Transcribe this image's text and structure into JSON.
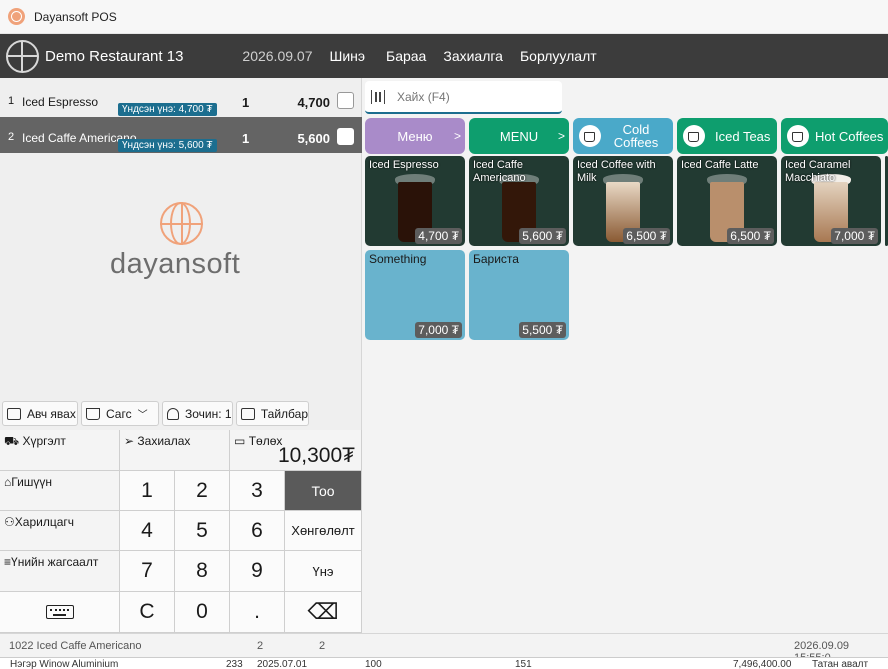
{
  "window": {
    "title": "Dayansoft POS"
  },
  "header": {
    "restaurant": "Demo Restaurant 13",
    "date": "2026.09.07",
    "nav": [
      "Шинэ",
      "Бараа",
      "Захиалга",
      "Борлуулалт"
    ]
  },
  "order": {
    "rows": [
      {
        "index": "1",
        "name": "Iced Espresso",
        "badge": "Үндсэн үнэ: 4,700 ₮",
        "qty": "1",
        "amount": "4,700"
      },
      {
        "index": "2",
        "name": "Iced Caffe Americano",
        "badge": "Үндсэн үнэ: 5,600 ₮",
        "qty": "1",
        "amount": "5,600"
      }
    ]
  },
  "brand": {
    "text": "dayansoft"
  },
  "actions": {
    "takeaway": "Авч явах",
    "cart": "Сагс",
    "guests": "Зочин: 1",
    "note": "Тайлбар"
  },
  "pad": {
    "delivery": "Хүргэлт",
    "order": "Захиалах",
    "payment": "Төлөх",
    "total": "10,300₮",
    "member": "Гишүүн",
    "customer": "Харилцагч",
    "price_list": "Үнийн жагсаалт",
    "qty": "Тоо",
    "discount": "Хөнгөлөлт",
    "price": "Үнэ",
    "keys": [
      "1",
      "2",
      "3",
      "4",
      "5",
      "6",
      "7",
      "8",
      "9",
      "C",
      "0",
      "."
    ]
  },
  "search": {
    "placeholder": "Хайх (F4)"
  },
  "categories": [
    {
      "label": "Меню",
      "arrow": ">",
      "color": "#a98bc9"
    },
    {
      "label": "MENU",
      "arrow": ">",
      "color": "#0e9e6e"
    },
    {
      "label": "Cold Coffees",
      "color": "#4aa9c9"
    },
    {
      "label": "Iced Teas",
      "color": "#0e9e6e"
    },
    {
      "label": "Hot Coffees",
      "color": "#0e9e6e"
    }
  ],
  "products": [
    {
      "name": "Iced Espresso",
      "price": "4,700 ₮"
    },
    {
      "name": "Iced Caffe Americano",
      "price": "5,600 ₮"
    },
    {
      "name": "Iced Coffee with Milk",
      "price": "6,500 ₮"
    },
    {
      "name": "Iced Caffe Latte",
      "price": "6,500 ₮"
    },
    {
      "name": "Iced Caramel Macchiato",
      "price": "7,000 ₮"
    },
    {
      "name": "Something",
      "price": "7,000 ₮"
    },
    {
      "name": "Бариста",
      "price": "5,500 ₮"
    }
  ],
  "status": {
    "item": "1022 Iced Caffe Americano",
    "count_a": "2",
    "count_b": "2",
    "datetime": "2026.09.09 15:55:0"
  },
  "background_row": {
    "name": "Нэгэр Winow Aluminium",
    "a": "233",
    "date": "2025.07.01",
    "b": "100",
    "c": "151",
    "amount": "7,496,400.00",
    "status": "Татан авалт"
  }
}
